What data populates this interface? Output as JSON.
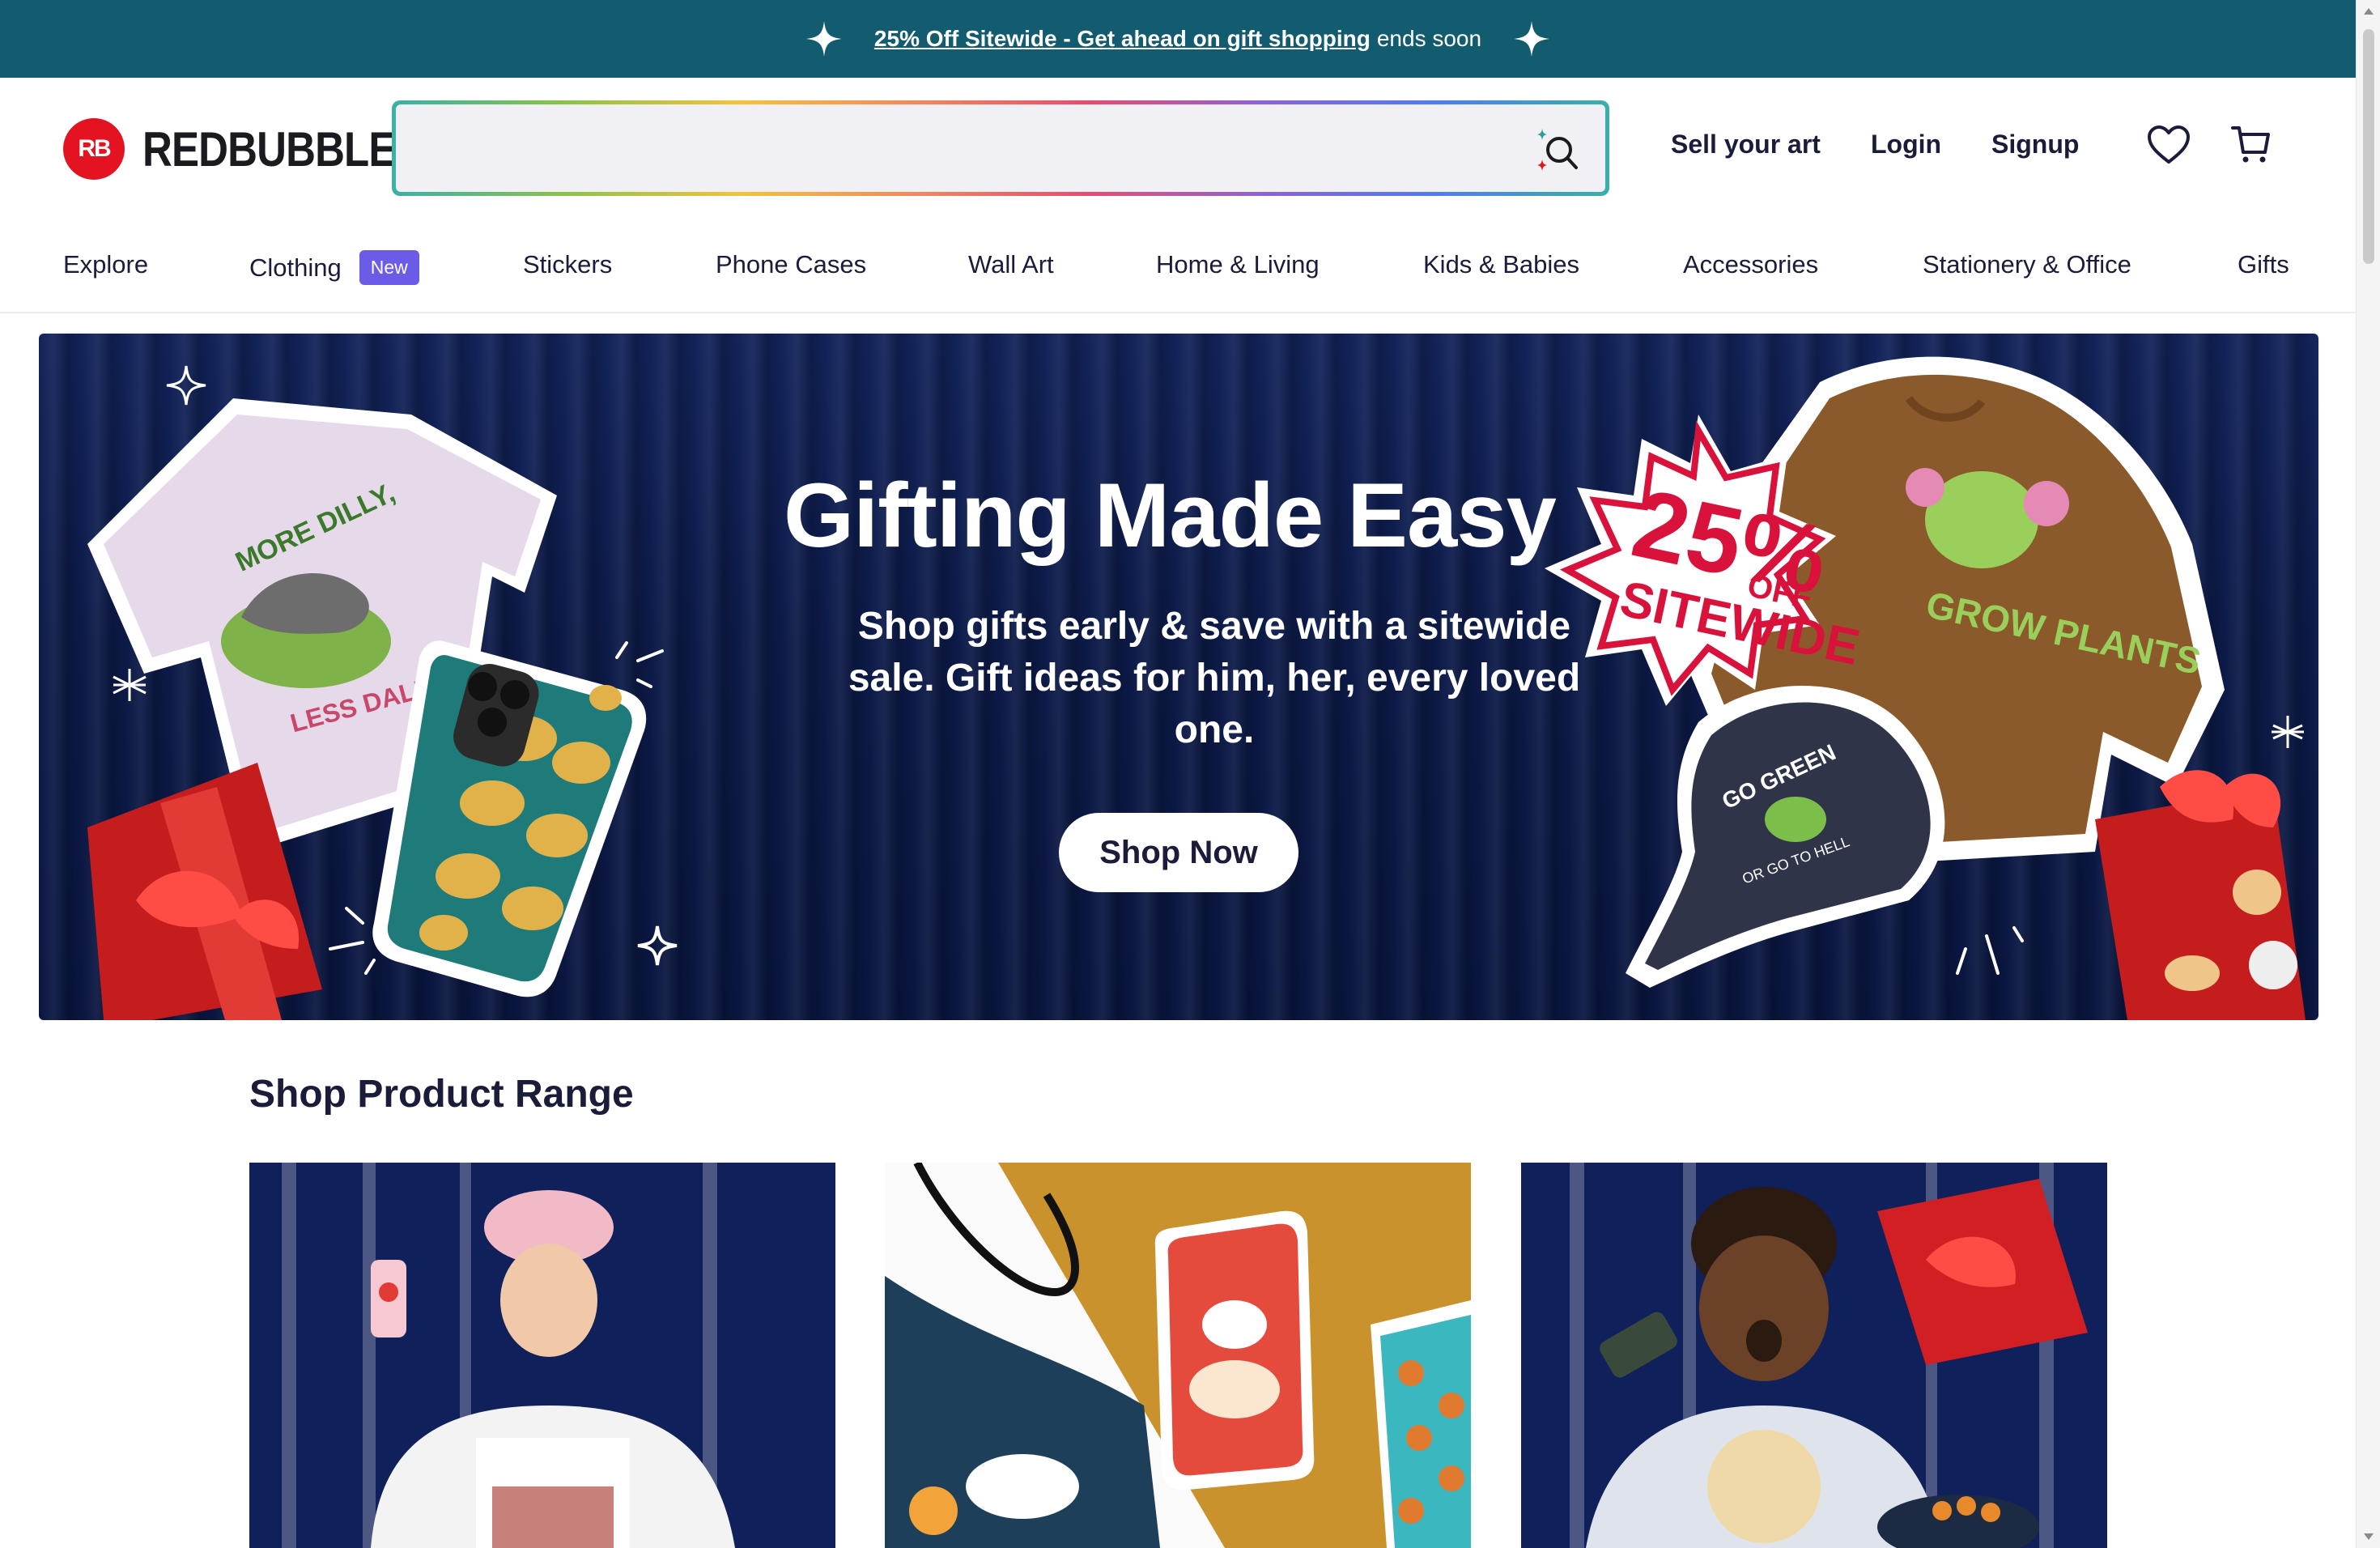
{
  "promo": {
    "link_text": "25% Off Sitewide - Get ahead on gift shopping",
    "suffix": "ends soon",
    "color": "#135c70"
  },
  "header": {
    "logo_badge": "RB",
    "logo_text": "REDBUBBLE",
    "search_placeholder": "",
    "sell": "Sell your art",
    "login": "Login",
    "signup": "Signup",
    "icons": [
      "sparkle-icon",
      "search-icon",
      "heart-icon",
      "cart-icon"
    ]
  },
  "nav": {
    "items": [
      "Explore",
      "Clothing",
      "Stickers",
      "Phone Cases",
      "Wall Art",
      "Home & Living",
      "Kids & Babies",
      "Accessories",
      "Stationery & Office",
      "Gifts"
    ],
    "new_badge": "New"
  },
  "hero": {
    "title": "Gifting Made Easy",
    "subtitle": "Shop gifts early & save with a sitewide sale. Gift ideas for him, her, every loved one.",
    "button": "Shop Now",
    "badge_top": "25%",
    "badge_off": "OFF",
    "badge_bottom": "SITEWIDE",
    "tee_top": "MORE DILLY,",
    "tee_bottom": "LESS DALLY",
    "sweater_text": "GROW PLANTS",
    "cap_top": "GO GREEN",
    "cap_bottom": "OR GO TO HELL"
  },
  "section": {
    "title": "Shop Product Range"
  }
}
